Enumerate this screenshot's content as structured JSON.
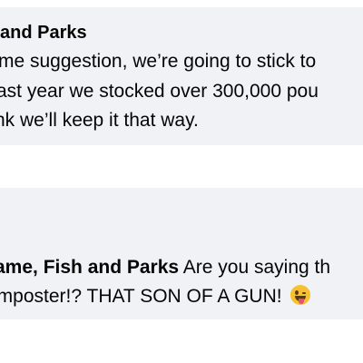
{
  "comments": [
    {
      "author": "and Parks",
      "lines": [
        "me suggestion, we’re going to stick to",
        "ast year we stocked over 300,000 pou",
        "nk we’ll keep it that way."
      ]
    },
    {
      "author": "ame, Fish and Parks",
      "line1_text": " Are you saying th",
      "line2_text": " imposter!? THAT SON OF A GUN! ",
      "emoji": "winking-face-with-tongue"
    }
  ],
  "colors": {
    "bubble": "#f0f2f5",
    "text": "#050505"
  }
}
